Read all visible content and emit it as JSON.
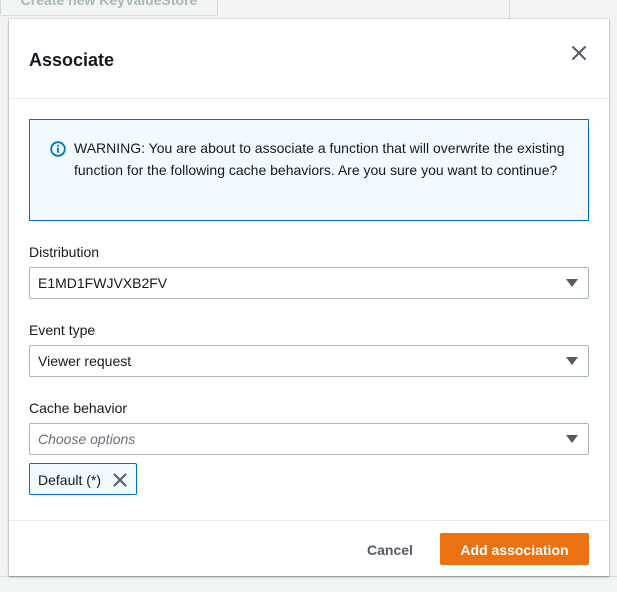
{
  "background": {
    "top_button_label": "Create new KeyValueStore"
  },
  "modal": {
    "title": "Associate",
    "close_icon": "close-icon",
    "alert": {
      "icon": "info-icon",
      "color": "#0073bb",
      "text": "WARNING: You are about to associate a function that will overwrite the existing function for the following cache behaviors. Are you sure you want to continue?"
    },
    "fields": {
      "distribution": {
        "label": "Distribution",
        "value": "E1MD1FWJVXB2FV"
      },
      "event_type": {
        "label": "Event type",
        "value": "Viewer request"
      },
      "cache_behavior": {
        "label": "Cache behavior",
        "placeholder": "Choose options",
        "selected_tokens": [
          "Default (*)"
        ]
      }
    },
    "footer": {
      "cancel_label": "Cancel",
      "submit_label": "Add association",
      "primary_color": "#ec7211"
    }
  }
}
